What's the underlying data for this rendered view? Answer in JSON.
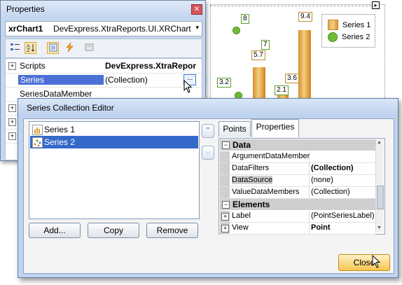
{
  "chart": {
    "legend": [
      {
        "label": "Series 1",
        "icon": "bar-series-icon",
        "color": "#e6a94b"
      },
      {
        "label": "Series 2",
        "icon": "point-series-icon",
        "color": "#6dbb35"
      }
    ],
    "labels": [
      "9.4",
      "5.7",
      "7",
      "3.2",
      "3.6",
      "2.1",
      "8"
    ],
    "colors": {
      "bar": "#e6a94b",
      "point": "#6dbb35"
    }
  },
  "properties_window": {
    "title": "Properties",
    "close_glyph": "✕",
    "object_name": "xrChart1",
    "object_type": "DevExpress.XtraReports.UI.XRChart",
    "combo_arrow": "▾",
    "toolbar_icons": [
      "categorized-icon",
      "alphabetical-icon",
      "properties-icon",
      "events-icon",
      "property-pages-icon"
    ],
    "rows": [
      {
        "expander": "+",
        "name": "Scripts",
        "value": "DevExpress.XtraRepor"
      },
      {
        "expander": "",
        "name": "Series",
        "value": "(Collection)",
        "ellipsis": "..."
      },
      {
        "expander": "",
        "name": "SeriesDataMember",
        "value": ""
      },
      {
        "expander": "+",
        "name": "",
        "value": ""
      },
      {
        "expander": "+",
        "name": "",
        "value": ""
      },
      {
        "expander": "+",
        "name": "",
        "value": ""
      }
    ]
  },
  "editor": {
    "title": "Series Collection Editor",
    "series": [
      {
        "label": "Series 1",
        "icon": "bar-series-icon"
      },
      {
        "label": "Series 2",
        "icon": "point-series-icon"
      }
    ],
    "buttons": {
      "add": "Add...",
      "copy": "Copy",
      "remove": "Remove",
      "close": "Close"
    },
    "nav": {
      "up": "⌃",
      "down": "⌄"
    },
    "tabs": [
      "Points",
      "Properties"
    ],
    "active_tab": "Properties",
    "grid": [
      {
        "kind": "category",
        "label": "Data",
        "expander": "−"
      },
      {
        "kind": "prop",
        "name": "ArgumentDataMember",
        "value": "",
        "bold": false
      },
      {
        "kind": "prop",
        "name": "DataFilters",
        "value": "(Collection)",
        "bold": true
      },
      {
        "kind": "prop",
        "name": "DataSource",
        "value": "(none)",
        "bold": false
      },
      {
        "kind": "prop",
        "name": "ValueDataMembers",
        "value": "(Collection)",
        "bold": false
      },
      {
        "kind": "category",
        "label": "Elements",
        "expander": "−"
      },
      {
        "kind": "prop",
        "name": "Label",
        "value": "(PointSeriesLabel)",
        "bold": false,
        "expander": "+"
      },
      {
        "kind": "prop",
        "name": "View",
        "value": "Point",
        "bold": true,
        "expander": "+"
      }
    ]
  }
}
